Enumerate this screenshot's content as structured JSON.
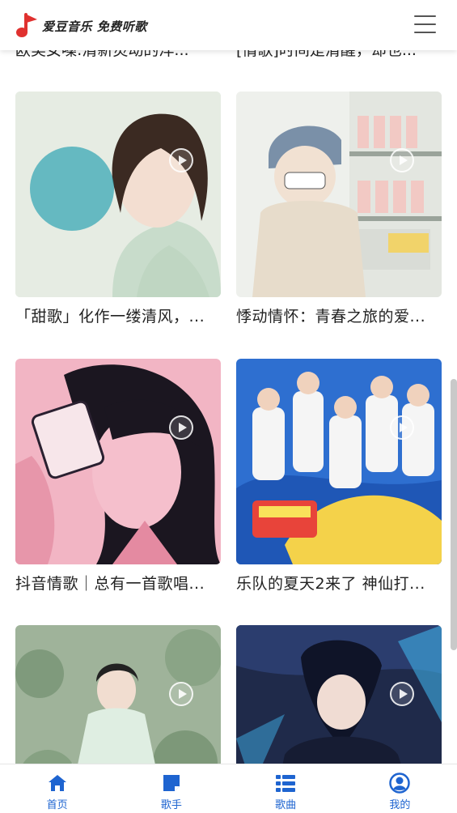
{
  "header": {
    "logo_text": "爱豆音乐 免费听歌",
    "menu_icon": "hamburger-menu-icon"
  },
  "previous_row": {
    "left_title": "欧美女嗓:清新灵动的洋...",
    "right_title": "[情歌]时间是清醒，却也..."
  },
  "playlists": [
    {
      "title": "「甜歌」化作一缕清风，...",
      "icon": "play-circle-icon"
    },
    {
      "title": "悸动情怀：青春之旅的爱...",
      "icon": "play-circle-icon"
    },
    {
      "title": "抖音情歌｜总有一首歌唱...",
      "icon": "play-circle-icon"
    },
    {
      "title": "乐队的夏天2来了 神仙打...",
      "icon": "play-circle-icon"
    },
    {
      "title": "",
      "icon": "play-circle-icon"
    },
    {
      "title": "",
      "icon": "play-circle-icon"
    }
  ],
  "bottom_nav": [
    {
      "label": "首页",
      "icon": "home-icon"
    },
    {
      "label": "歌手",
      "icon": "singer-icon"
    },
    {
      "label": "歌曲",
      "icon": "song-list-icon"
    },
    {
      "label": "我的",
      "icon": "user-icon"
    }
  ],
  "colors": {
    "accent": "#1e64d0",
    "logo_red": "#e0312f"
  }
}
